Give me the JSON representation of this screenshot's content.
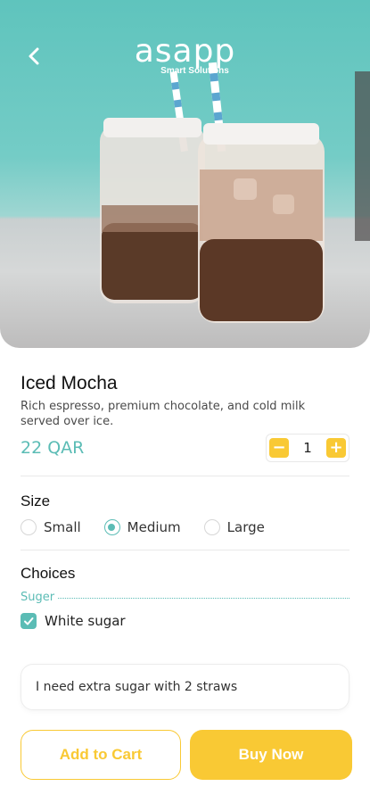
{
  "header": {
    "logo_word": "asapp",
    "logo_sub": "Smart Solutions",
    "back_icon": "chevron-left-icon"
  },
  "product": {
    "name": "Iced Mocha",
    "description": "Rich espresso, premium chocolate, and cold milk served over ice.",
    "price": "22 QAR",
    "quantity": "1",
    "decrement_label": "−",
    "increment_label": "+"
  },
  "size": {
    "title": "Size",
    "options": [
      {
        "label": "Small",
        "selected": false
      },
      {
        "label": "Medium",
        "selected": true
      },
      {
        "label": "Large",
        "selected": false
      }
    ]
  },
  "choices": {
    "title": "Choices",
    "group_label": "Suger",
    "items": [
      {
        "label": "White sugar",
        "checked": true
      }
    ]
  },
  "note": {
    "value": "I need extra sugar with 2 straws"
  },
  "actions": {
    "add_to_cart": "Add to Cart",
    "buy_now": "Buy Now"
  },
  "colors": {
    "accent_teal": "#5bbcb5",
    "accent_yellow": "#f9c934"
  }
}
